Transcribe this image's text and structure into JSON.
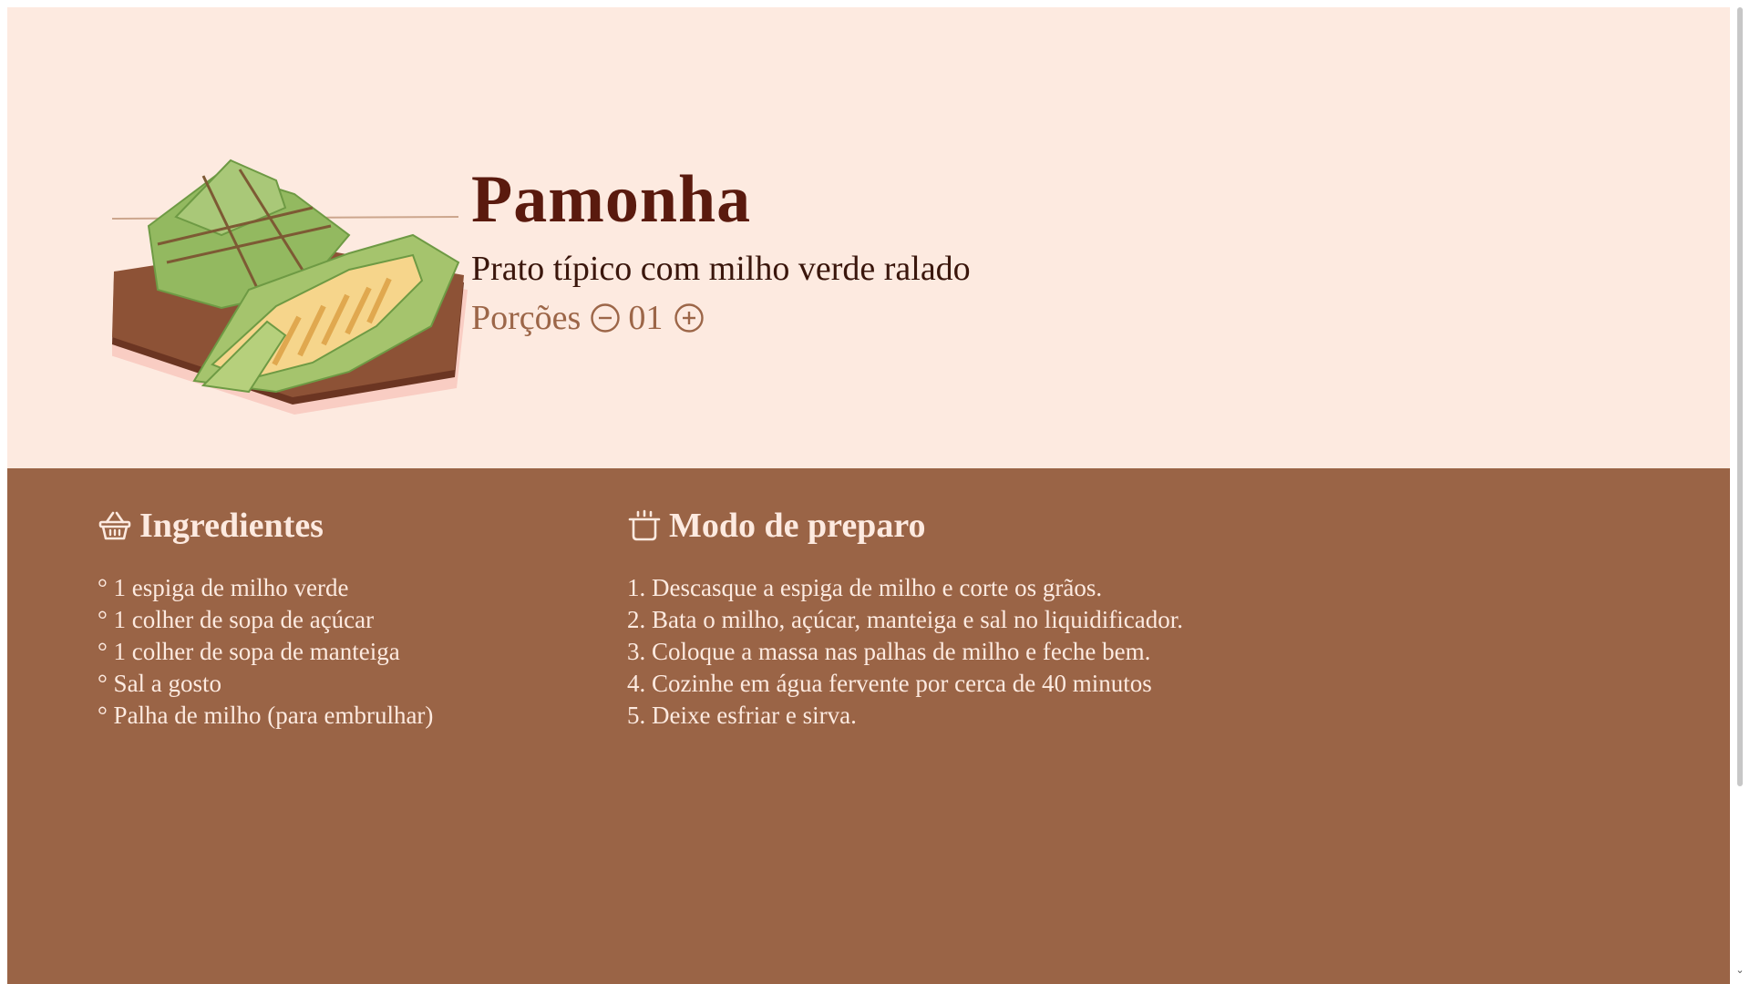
{
  "recipe": {
    "title": "Pamonha",
    "subtitle": "Prato típico com milho verde ralado",
    "portions_label": "Porções",
    "portions_value": "01",
    "decrement_icon": "minus-circle-icon",
    "increment_icon": "plus-circle-icon"
  },
  "ingredients": {
    "heading": "Ingredientes",
    "icon": "basket-icon",
    "items": [
      "° 1 espiga de milho verde",
      "° 1 colher de sopa de açúcar",
      "° 1 colher de sopa de manteiga",
      "° Sal a gosto",
      "° Palha de milho (para embrulhar)"
    ]
  },
  "preparation": {
    "heading": "Modo de preparo",
    "icon": "cooking-pot-icon",
    "steps": [
      "1. Descasque a espiga de milho e corte os grãos.",
      "2. Bata o milho, açúcar, manteiga e sal no liquidificador.",
      "3. Coloque a massa nas palhas de milho e feche bem.",
      "4. Cozinhe em água fervente por cerca de 40 minutos",
      "5. Deixe esfriar e sirva."
    ]
  },
  "colors": {
    "hero_background": "#fdeae0",
    "content_background": "#9a6446",
    "title": "#5a1a0e",
    "portions": "#9c6648",
    "content_text": "#fdeae0"
  },
  "scrollbar": {
    "down_icon": "chevron-down-icon"
  }
}
